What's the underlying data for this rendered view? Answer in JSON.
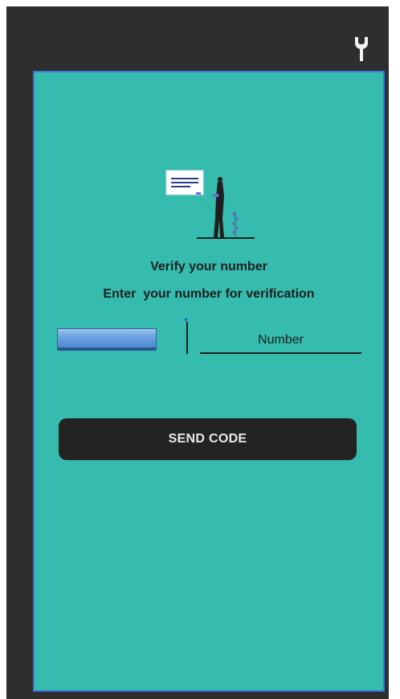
{
  "top_bar": {
    "icon": "wrench-icon"
  },
  "illustration": {
    "icon": "person-with-message-illustration"
  },
  "verify": {
    "title": "Verify your number",
    "subtitle": "Enter  your number for verification"
  },
  "phone_form": {
    "country_selector": "",
    "number_placeholder": "Number",
    "number_value": ""
  },
  "actions": {
    "send_code_label": "SEND CODE"
  },
  "colors": {
    "device_background": "#2e2e2f",
    "screen_background": "#36bcae",
    "screen_border": "#3a77d8",
    "button_background": "#222322",
    "button_text": "#e9e9e9",
    "text": "#1e1e1e"
  }
}
